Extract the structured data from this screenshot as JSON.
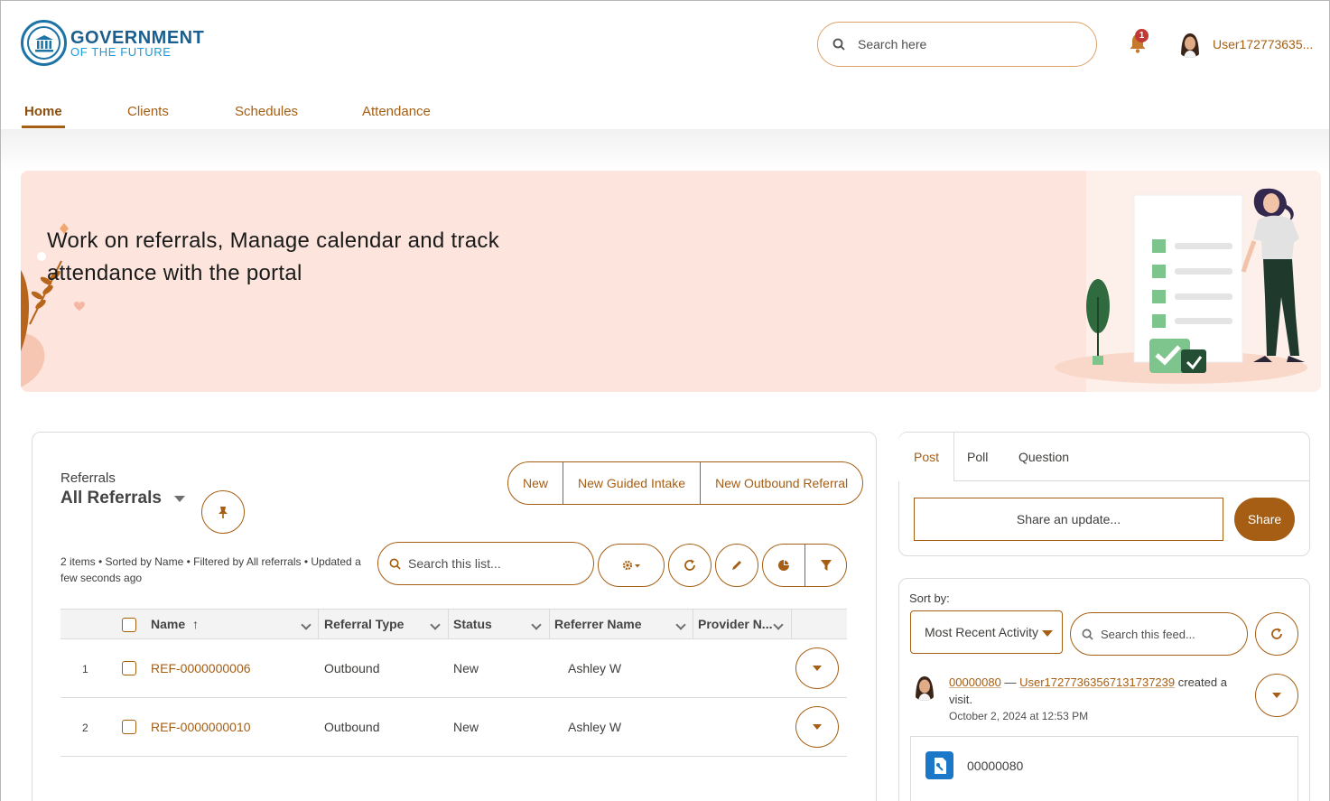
{
  "brand": {
    "line1": "GOVERNMENT",
    "line2": "OF THE FUTURE"
  },
  "header": {
    "search_placeholder": "Search here",
    "notification_count": "1",
    "user_name": "User172773635..."
  },
  "nav": {
    "items": [
      {
        "label": "Home",
        "active": true
      },
      {
        "label": "Clients"
      },
      {
        "label": "Schedules"
      },
      {
        "label": "Attendance"
      }
    ]
  },
  "hero": {
    "title": "Work on referrals, Manage calendar and track attendance with the portal"
  },
  "referrals": {
    "object_label": "Referrals",
    "list_view": "All Referrals",
    "buttons": {
      "new": "New",
      "guided_intake": "New Guided Intake",
      "outbound": "New Outbound Referral"
    },
    "meta": "2 items • Sorted by Name • Filtered by All referrals • Updated a few seconds ago",
    "search_placeholder": "Search this list...",
    "columns": [
      "Name",
      "Referral Type",
      "Status",
      "Referrer Name",
      "Provider N..."
    ],
    "sort_indicator": "↑",
    "rows": [
      {
        "index": "1",
        "name": "REF-0000000006",
        "type": "Outbound",
        "status": "New",
        "referrer": "Ashley W",
        "provider": ""
      },
      {
        "index": "2",
        "name": "REF-0000000010",
        "type": "Outbound",
        "status": "New",
        "referrer": "Ashley W",
        "provider": ""
      }
    ]
  },
  "publisher": {
    "tabs": [
      "Post",
      "Poll",
      "Question"
    ],
    "active_tab": "Post",
    "input_placeholder": "Share an update...",
    "share_label": "Share"
  },
  "feed": {
    "sort_label": "Sort by:",
    "sort_value": "Most Recent Activity",
    "search_placeholder": "Search this feed...",
    "item": {
      "record_link": "00000080",
      "dash": " — ",
      "user_link": "User17277363567131737239",
      "action": " created a visit.",
      "timestamp": "October 2, 2024 at 12:53 PM",
      "card_title": "00000080"
    }
  },
  "colors": {
    "accent": "#a55e13",
    "hero_bg": "#fde5dd",
    "brand_blue": "#1b73a6",
    "badge": "#c23934"
  }
}
